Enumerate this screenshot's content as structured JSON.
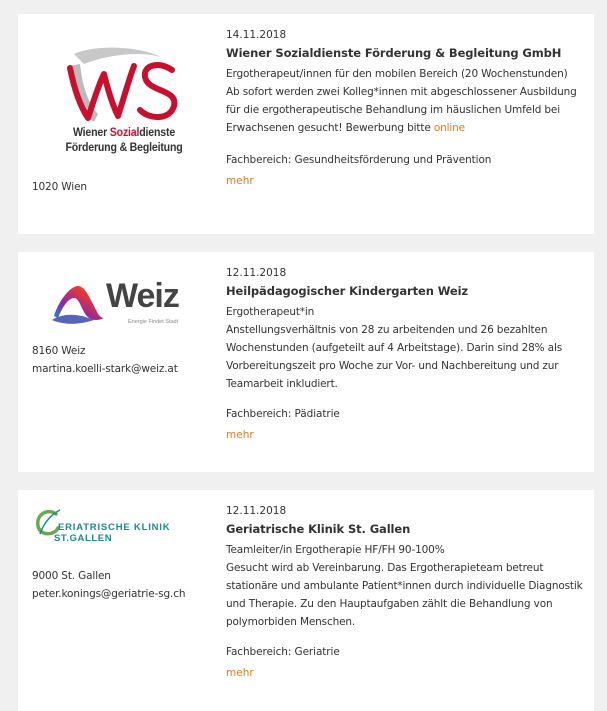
{
  "colors": {
    "accent": "#e07a1f",
    "ws_red": "#c8102e",
    "ws_gray": "#8e8e8e",
    "geriatrie_green": "#6aa84f",
    "geriatrie_teal": "#1a8a8a"
  },
  "listings": [
    {
      "logo": {
        "kind": "ws",
        "mark": "WS",
        "line1_a": "Wiener ",
        "line1_b": "Sozial",
        "line1_c": "dienste",
        "line2": "Förderung & Begleitung"
      },
      "address": "1020 Wien",
      "email": "",
      "date": "14.11.2018",
      "company": "Wiener Sozialdienste Förderung & Begleitung GmbH",
      "position": "Ergotherapeut/innen für den mobilen Bereich (20 Wochenstunden)",
      "body": "Ab sofort werden zwei Kolleg*innen mit abgeschlossener Ausbildung für die ergotherapeutische Behandlung im häuslichen Umfeld bei Erwachsenen gesucht! Bewerbung bitte ",
      "body_link": "online",
      "field": "Fachbereich: Gesundheitsförderung und Prävention",
      "more": "mehr"
    },
    {
      "logo": {
        "kind": "weiz",
        "mark": "Weiz",
        "tagline": "Energie Findet Stadt"
      },
      "address": "8160 Weiz",
      "email": "martina.koelli-stark@weiz.at",
      "date": "12.11.2018",
      "company": "Heilpädagogischer Kindergarten Weiz",
      "position": "Ergotherapeut*in",
      "body": "Anstellungsverhältnis von 28 zu arbeitenden und 26 bezahlten Wochenstunden (aufgeteilt auf 4 Arbeitstage). Darin sind 28% als Vorbereitungszeit pro Woche zur Vor- und Nachbereitung und zur Teamarbeit inkludiert.",
      "body_link": "",
      "field": "Fachbereich: Pädiatrie",
      "more": "mehr"
    },
    {
      "logo": {
        "kind": "geriatrie",
        "line1": "ERIATRISCHE KLINIK",
        "line2": "ST.GALLEN"
      },
      "address": "9000 St. Gallen",
      "email": "peter.konings@geriatrie-sg.ch",
      "date": "12.11.2018",
      "company": "Geriatrische Klinik St. Gallen",
      "position": "Teamleiter/in Ergotherapie HF/FH 90-100%",
      "body": "Gesucht wird ab Vereinbarung. Das Ergotherapieteam betreut stationäre und ambulante Patient*innen durch individuelle Diagnostik und Therapie. Zu den Hauptaufgaben zählt die Behandlung von polymorbiden Menschen.",
      "body_link": "",
      "field": "Fachbereich: Geriatrie",
      "more": "mehr"
    }
  ]
}
